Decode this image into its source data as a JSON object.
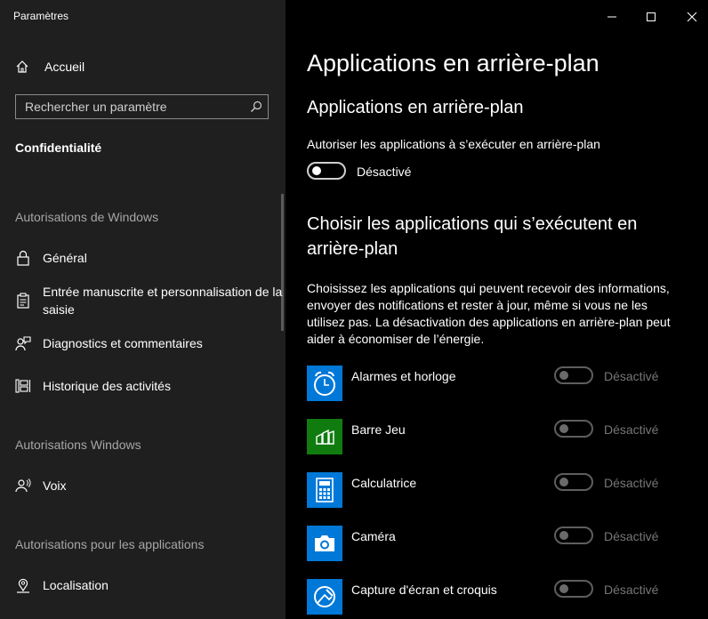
{
  "window": {
    "title": "Paramètres"
  },
  "sidebar": {
    "home_label": "Accueil",
    "search_placeholder": "Rechercher un paramètre",
    "current_section": "Confidentialité",
    "groups": [
      {
        "title": "Autorisations de Windows"
      },
      {
        "title": "Autorisations Windows"
      },
      {
        "title": "Autorisations pour les applications"
      }
    ],
    "items": [
      {
        "label": "Général",
        "icon": "lock-icon"
      },
      {
        "label": "Entrée manuscrite et personnalisation de la saisie",
        "icon": "clipboard-icon"
      },
      {
        "label": "Diagnostics et commentaires",
        "icon": "feedback-person-icon"
      },
      {
        "label": "Historique des activités",
        "icon": "timeline-icon"
      },
      {
        "label": "Voix",
        "icon": "voice-person-icon"
      },
      {
        "label": "Localisation",
        "icon": "location-pin-icon"
      }
    ]
  },
  "main": {
    "page_title": "Applications en arrière-plan",
    "section_title": "Applications en arrière-plan",
    "allow_label": "Autoriser les applications à s’exécuter en arrière-plan",
    "allow_state": "Désactivé",
    "choose_title": "Choisir les applications qui s’exécutent en arrière-plan",
    "description": "Choisissez les applications qui peuvent recevoir des informations, envoyer des notifications et rester à jour, même si vous ne les utilisez pas. La désactivation des applications en arrière-plan peut aider à économiser de l’énergie.",
    "apps": [
      {
        "name": "Alarmes et horloge",
        "state": "Désactivé",
        "icon": "alarm-clock-icon",
        "color": "#0078d7"
      },
      {
        "name": "Barre Jeu",
        "state": "Désactivé",
        "icon": "game-bar-icon",
        "color": "#107c10"
      },
      {
        "name": "Calculatrice",
        "state": "Désactivé",
        "icon": "calculator-icon",
        "color": "#0078d7"
      },
      {
        "name": "Caméra",
        "state": "Désactivé",
        "icon": "camera-icon",
        "color": "#0078d7"
      },
      {
        "name": "Capture d'écran et croquis",
        "state": "Désactivé",
        "icon": "snip-sketch-icon",
        "color": "#0078d7"
      }
    ]
  }
}
